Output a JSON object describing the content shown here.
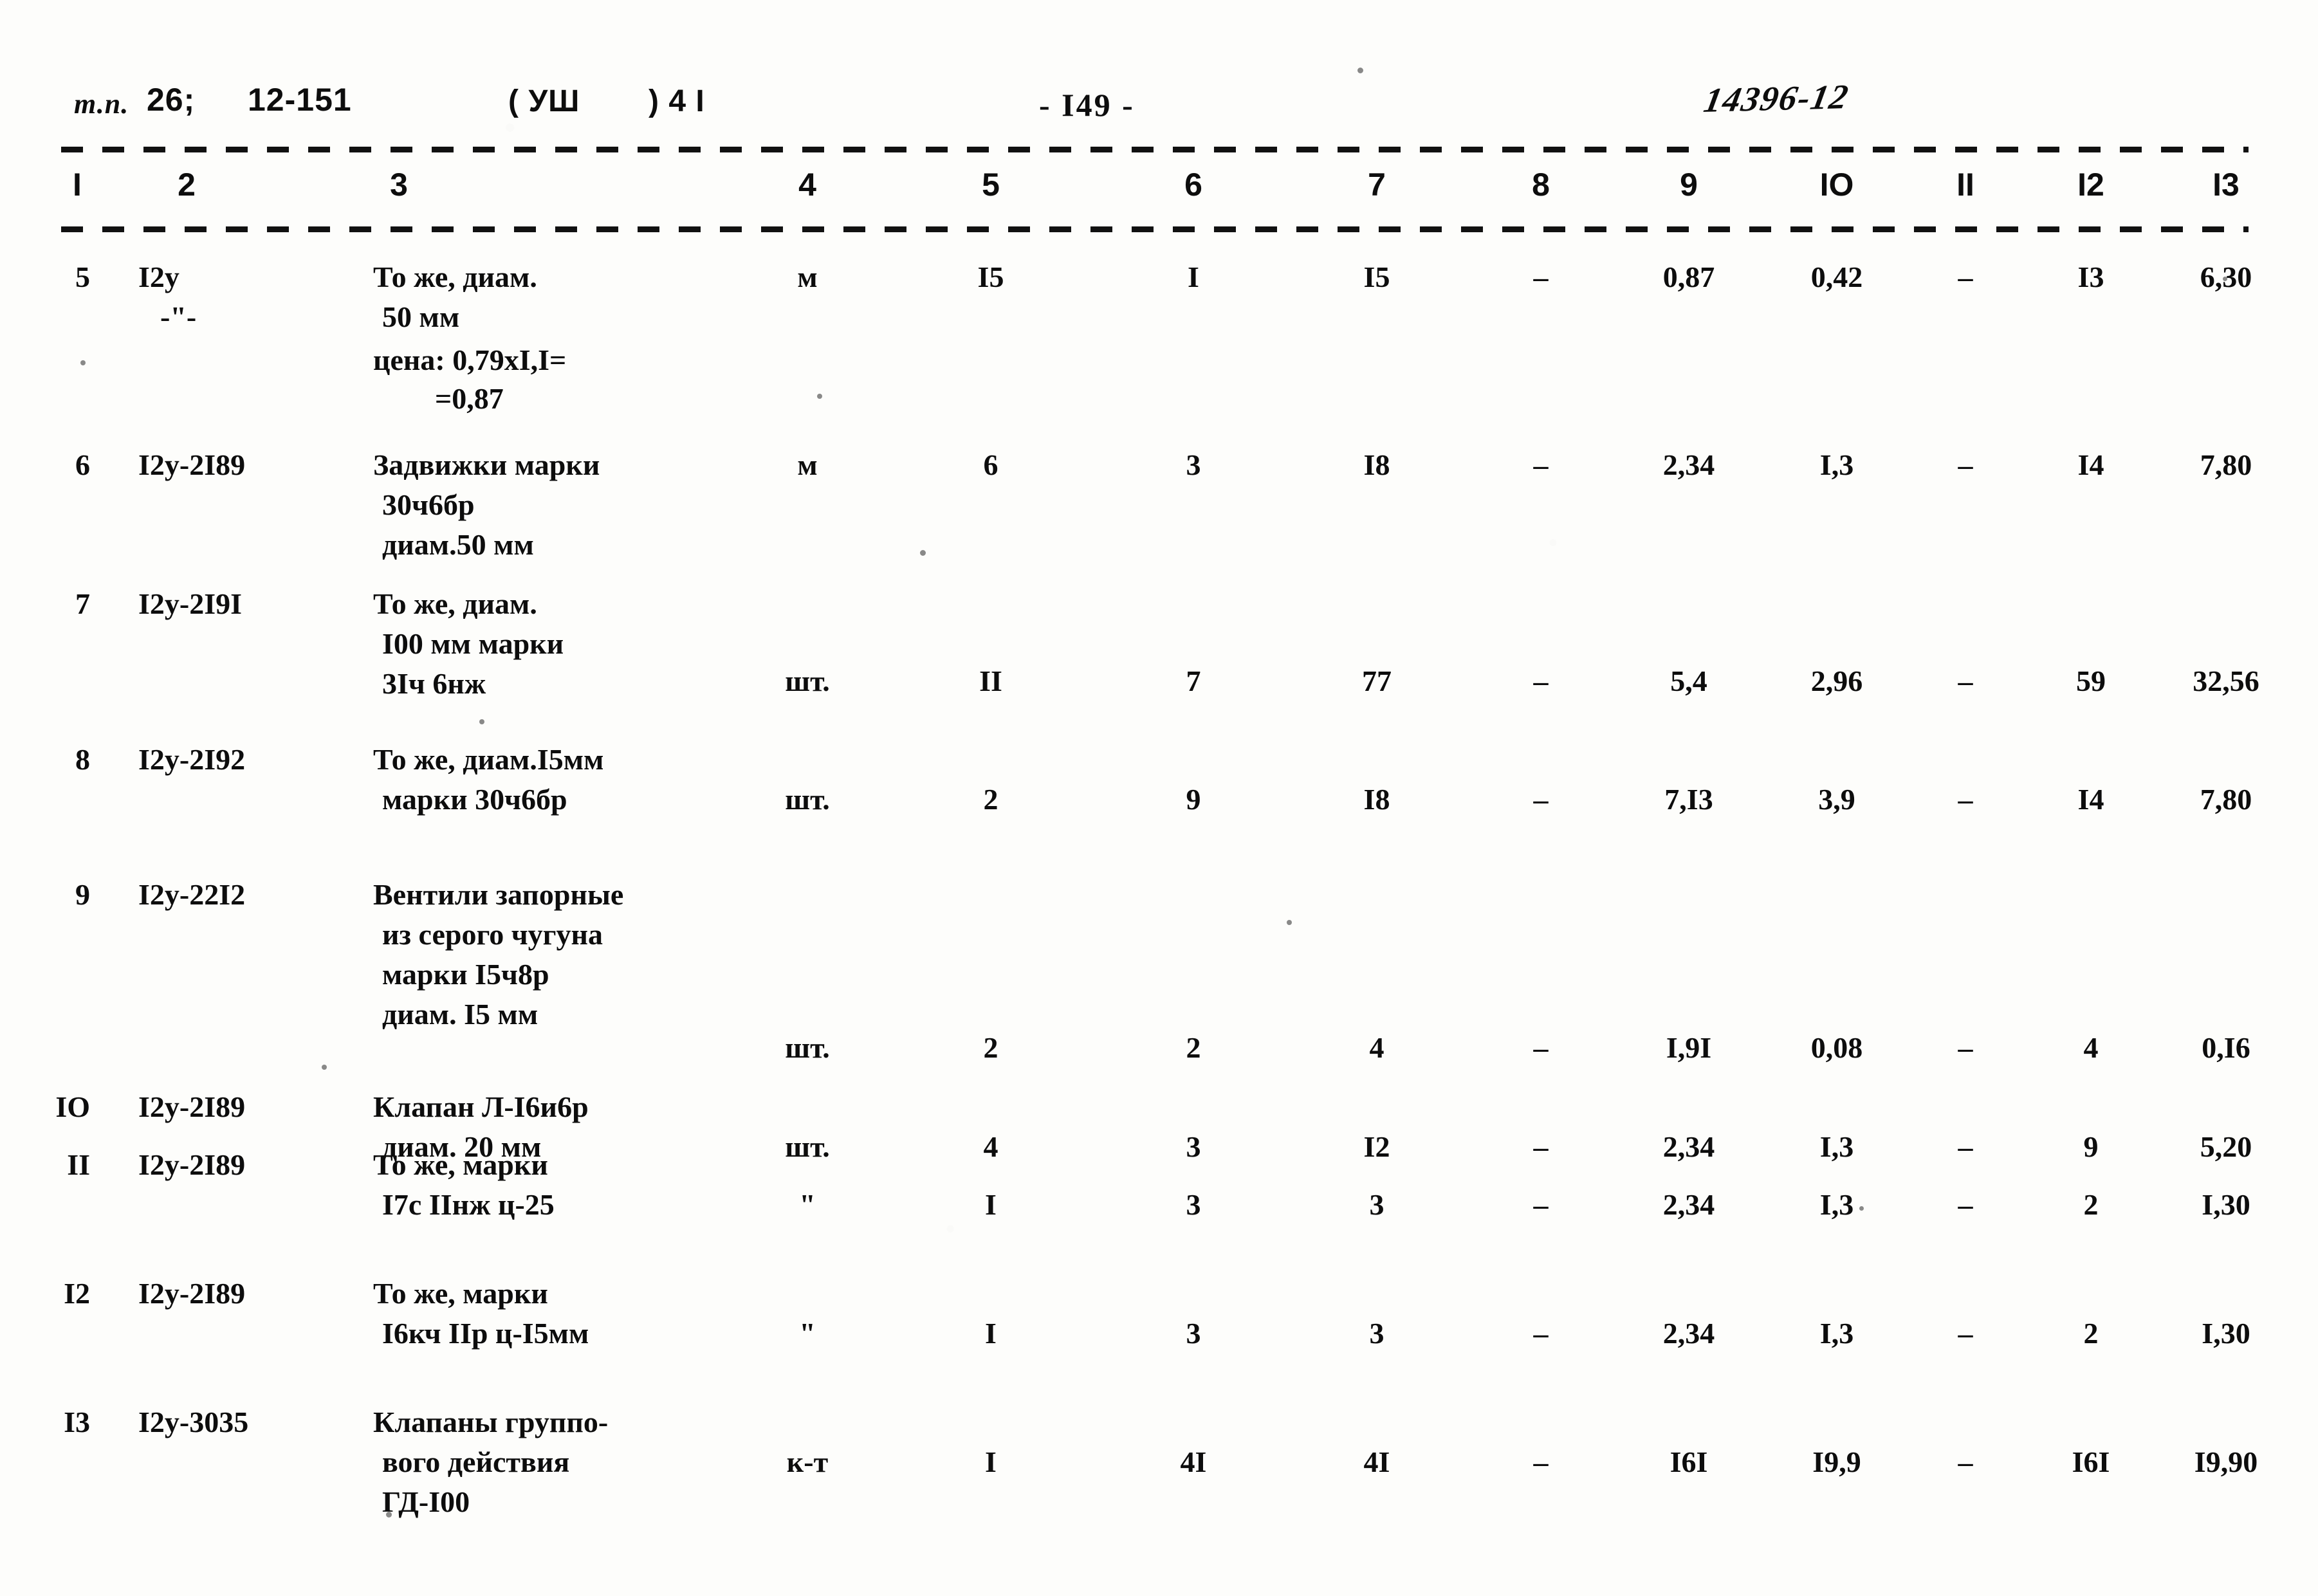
{
  "header": {
    "tp_label": "т.п.",
    "tp_number": "26;",
    "doc_code": "12-151",
    "section_open": "( УШ ",
    "section_close": ") 4 I",
    "page_number": "- I49 -",
    "stamp_number": "14396-12"
  },
  "column_headers": [
    "I",
    "2",
    "3",
    "4",
    "5",
    "6",
    "7",
    "8",
    "9",
    "IO",
    "II",
    "I2",
    "I3"
  ],
  "rows": [
    {
      "num": "5",
      "code": "I2y",
      "code_line2": "-\"-",
      "desc": [
        "То же, диам.",
        "50 мм"
      ],
      "note": [
        "цена: 0,79xI,I=",
        "=0,87"
      ],
      "unit": "м",
      "c5": "I5",
      "c6": "I",
      "c7": "I5",
      "c8": "–",
      "c9": "0,87",
      "c10": "0,42",
      "c11": "–",
      "c12": "I3",
      "c13": "6,30"
    },
    {
      "num": "6",
      "code": "I2y-2I89",
      "desc": [
        "Задвижки марки",
        "30ч6бр",
        "диам.50 мм"
      ],
      "unit": "м",
      "c5": "6",
      "c6": "3",
      "c7": "I8",
      "c8": "–",
      "c9": "2,34",
      "c10": "I,3",
      "c11": "–",
      "c12": "I4",
      "c13": "7,80"
    },
    {
      "num": "7",
      "code": "I2y-2I9I",
      "desc": [
        "То же, диам.",
        "I00 мм марки",
        "3Iч 6нж"
      ],
      "unit": "шт.",
      "c5": "II",
      "c6": "7",
      "c7": "77",
      "c8": "–",
      "c9": "5,4",
      "c10": "2,96",
      "c11": "–",
      "c12": "59",
      "c13": "32,56"
    },
    {
      "num": "8",
      "code": "I2y-2I92",
      "desc": [
        "То же, диам.I5мм",
        "марки 30ч6бр"
      ],
      "unit": "шт.",
      "c5": "2",
      "c6": "9",
      "c7": "I8",
      "c8": "–",
      "c9": "7,I3",
      "c10": "3,9",
      "c11": "–",
      "c12": "I4",
      "c13": "7,80"
    },
    {
      "num": "9",
      "code": "I2y-22I2",
      "desc": [
        "Вентили запорные",
        "из серого чугуна",
        "марки I5ч8р",
        "диам. I5 мм"
      ],
      "unit": "шт.",
      "c5": "2",
      "c6": "2",
      "c7": "4",
      "c8": "–",
      "c9": "I,9I",
      "c10": "0,08",
      "c11": "–",
      "c12": "4",
      "c13": "0,I6"
    },
    {
      "num": "IO",
      "code": "I2y-2I89",
      "desc": [
        "Клапан Л-I6и6р",
        "диам. 20 мм"
      ],
      "unit": "шт.",
      "c5": "4",
      "c6": "3",
      "c7": "I2",
      "c8": "–",
      "c9": "2,34",
      "c10": "I,3",
      "c11": "–",
      "c12": "9",
      "c13": "5,20"
    },
    {
      "num": "II",
      "code": "I2y-2I89",
      "desc": [
        "То же, марки",
        "I7с IIнж ц-25"
      ],
      "unit": "\"",
      "c5": "I",
      "c6": "3",
      "c7": "3",
      "c8": "–",
      "c9": "2,34",
      "c10": "I,3",
      "c11": "–",
      "c12": "2",
      "c13": "I,30"
    },
    {
      "num": "I2",
      "code": "I2y-2I89",
      "desc": [
        "То же, марки",
        "I6кч IIр ц-I5мм"
      ],
      "unit": "\"",
      "c5": "I",
      "c6": "3",
      "c7": "3",
      "c8": "–",
      "c9": "2,34",
      "c10": "I,3",
      "c11": "–",
      "c12": "2",
      "c13": "I,30"
    },
    {
      "num": "I3",
      "code": "I2y-3035",
      "desc": [
        "Клапаны группо-",
        "вого действия",
        "ГД-I00"
      ],
      "unit": "к-т",
      "c5": "I",
      "c6": "4I",
      "c7": "4I",
      "c8": "–",
      "c9": "I6I",
      "c10": "I9,9",
      "c11": "–",
      "c12": "I6I",
      "c13": "I9,90"
    }
  ]
}
